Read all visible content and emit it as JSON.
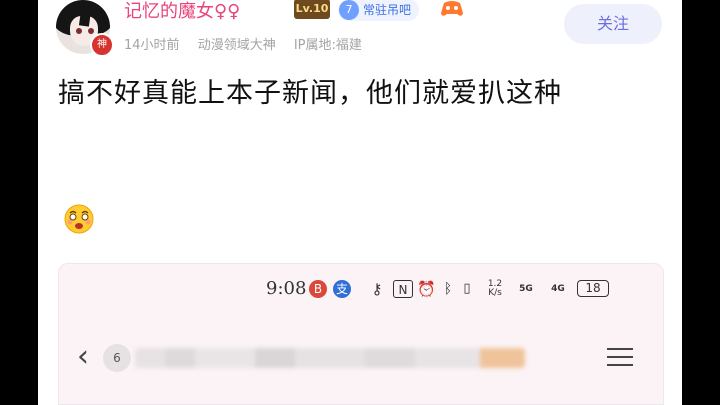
{
  "post": {
    "author": {
      "name": "记忆的魔女♀♀",
      "level": "Lv.10",
      "badge_text": "神",
      "fan_level": "7",
      "fan_label": "常驻吊吧"
    },
    "meta": {
      "time": "14小时前",
      "title": "动漫领域大神",
      "ip": "IP属地:福建"
    },
    "follow_label": "关注",
    "content": "搞不好真能上本子新闻，他们就爱扒这种",
    "screenshot": {
      "status_time": "9:08",
      "net_speed": "1.2 K/s",
      "signal_label": "5G",
      "signal_label2": "4G",
      "battery": "18",
      "tab_count": "6"
    }
  },
  "colors": {
    "name": "#e8457a",
    "follow_bg": "#eef0fb",
    "follow_text": "#6c6fe0",
    "meta": "#a4a4a4"
  },
  "icons": [
    "god-badge-icon",
    "game-controller-icon",
    "astonished-emoji-icon",
    "back-arrow-icon",
    "menu-icon"
  ]
}
